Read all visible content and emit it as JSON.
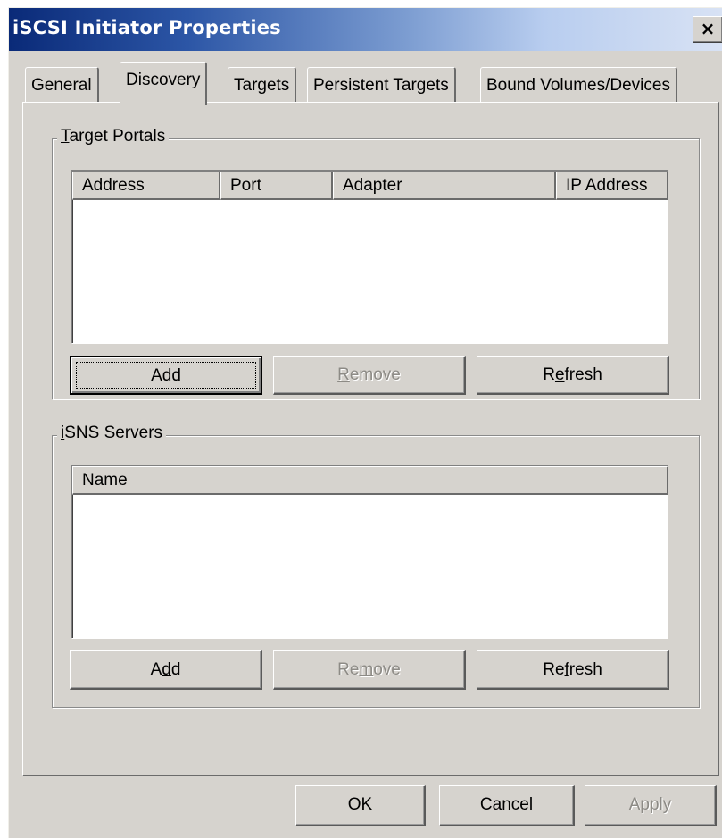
{
  "window": {
    "title": "iSCSI Initiator Properties",
    "close_glyph": "×"
  },
  "tabs": [
    {
      "label": "General",
      "active": false
    },
    {
      "label": "Discovery",
      "active": true
    },
    {
      "label": "Targets",
      "active": false
    },
    {
      "label": "Persistent Targets",
      "active": false
    },
    {
      "label": "Bound Volumes/Devices",
      "active": false
    }
  ],
  "target_portals": {
    "title_mnemonic": "T",
    "title_rest": "arget Portals",
    "columns": [
      "Address",
      "Port",
      "Adapter",
      "IP Address"
    ],
    "rows": [],
    "buttons": {
      "add": {
        "pre": "",
        "mnemonic": "A",
        "post": "dd",
        "enabled": true
      },
      "remove": {
        "pre": "",
        "mnemonic": "R",
        "post": "emove",
        "enabled": false
      },
      "refresh": {
        "pre": "R",
        "mnemonic": "e",
        "post": "fresh",
        "enabled": true
      }
    }
  },
  "isns_servers": {
    "title_mnemonic": "i",
    "title_rest": "SNS Servers",
    "columns": [
      "Name"
    ],
    "rows": [],
    "buttons": {
      "add": {
        "pre": "A",
        "mnemonic": "d",
        "post": "d",
        "enabled": true
      },
      "remove": {
        "pre": "Re",
        "mnemonic": "m",
        "post": "ove",
        "enabled": false
      },
      "refresh": {
        "pre": "Re",
        "mnemonic": "f",
        "post": "resh",
        "enabled": true
      }
    }
  },
  "footer": {
    "ok_label": "OK",
    "cancel_label": "Cancel",
    "apply_label": "Apply",
    "apply_enabled": false
  },
  "colors": {
    "title_gradient_start": "#0a2a78",
    "title_gradient_end": "#d8e2f4",
    "dialog_face": "#d6d3ce",
    "disabled_text": "#8d8b86"
  }
}
